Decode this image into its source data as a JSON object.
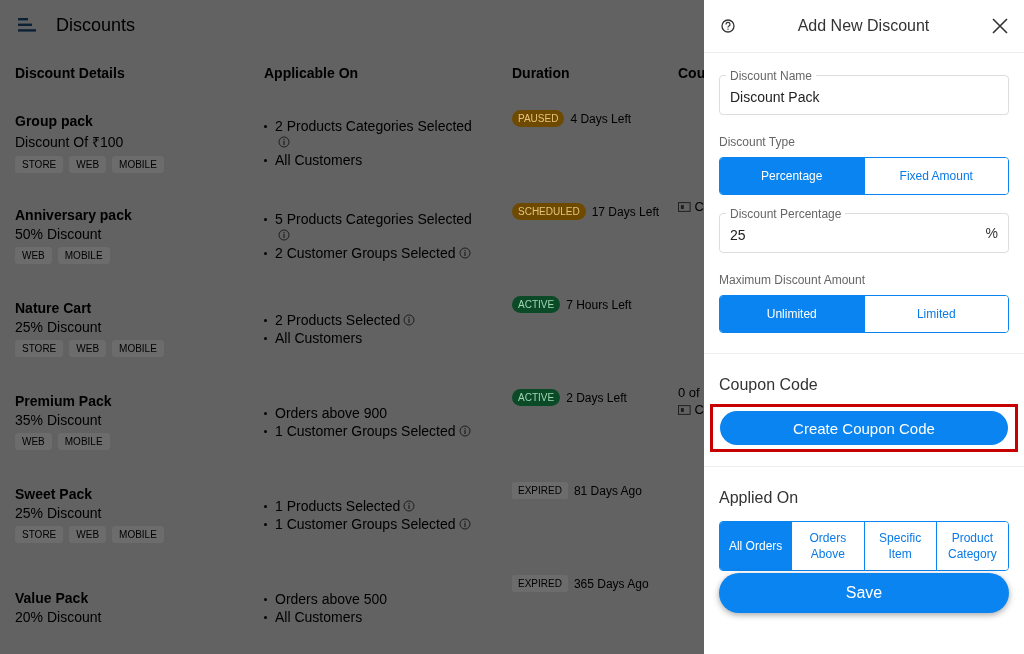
{
  "page": {
    "title": "Discounts"
  },
  "table": {
    "columns": [
      "Discount Details",
      "Applicable On",
      "Duration",
      "Cou"
    ],
    "rows": [
      {
        "name": "Group pack",
        "amount": "Discount Of ₹100",
        "channels": [
          "STORE",
          "WEB",
          "MOBILE"
        ],
        "applicable": [
          {
            "text": "2 Products Categories Selected",
            "info": true
          },
          {
            "text": "All Customers",
            "info": false
          }
        ],
        "status": {
          "kind": "paused",
          "label": "PAUSED"
        },
        "time": "4 Days Left",
        "coupons": []
      },
      {
        "name": "Anniversary pack",
        "amount": "50% Discount",
        "channels": [
          "WEB",
          "MOBILE"
        ],
        "applicable": [
          {
            "text": "5 Products Categories Selected",
            "info": true
          },
          {
            "text": "2 Customer Groups Selected",
            "info": true
          }
        ],
        "status": {
          "kind": "scheduled",
          "label": "SCHEDULED"
        },
        "time": "17 Days Left",
        "coupons": [
          {
            "kind": "ticket",
            "text": "C"
          }
        ]
      },
      {
        "name": "Nature Cart",
        "amount": "25% Discount",
        "channels": [
          "STORE",
          "WEB",
          "MOBILE"
        ],
        "applicable": [
          {
            "text": "2 Products Selected",
            "info": true
          },
          {
            "text": "All Customers",
            "info": false
          }
        ],
        "status": {
          "kind": "active",
          "label": "ACTIVE"
        },
        "time": "7 Hours Left",
        "coupons": []
      },
      {
        "name": "Premium Pack",
        "amount": "35% Discount",
        "channels": [
          "WEB",
          "MOBILE"
        ],
        "applicable": [
          {
            "text": "Orders above 900",
            "info": false
          },
          {
            "text": "1 Customer Groups Selected",
            "info": true
          }
        ],
        "status": {
          "kind": "active",
          "label": "ACTIVE"
        },
        "time": "2 Days Left",
        "coupons": [
          {
            "kind": "text",
            "text": "0 of"
          },
          {
            "kind": "ticket",
            "text": "C"
          }
        ]
      },
      {
        "name": "Sweet Pack",
        "amount": "25% Discount",
        "channels": [
          "STORE",
          "WEB",
          "MOBILE"
        ],
        "applicable": [
          {
            "text": "1 Products Selected",
            "info": true
          },
          {
            "text": "1 Customer Groups Selected",
            "info": true
          }
        ],
        "status": {
          "kind": "expired",
          "label": "EXPIRED"
        },
        "time": "81 Days Ago",
        "coupons": []
      },
      {
        "name": "Value Pack",
        "amount": "20% Discount",
        "channels": [],
        "applicable": [
          {
            "text": "Orders above 500",
            "info": false
          },
          {
            "text": "All Customers",
            "info": false
          }
        ],
        "status": {
          "kind": "expired",
          "label": "EXPIRED"
        },
        "time": "365 Days Ago",
        "coupons": []
      }
    ]
  },
  "panel": {
    "title": "Add New Discount",
    "name_field": {
      "label": "Discount Name",
      "value": "Discount Pack"
    },
    "discount_type": {
      "label": "Discount Type",
      "options": [
        {
          "label": "Percentage",
          "selected": true
        },
        {
          "label": "Fixed Amount",
          "selected": false
        }
      ]
    },
    "percentage_field": {
      "label": "Discount Percentage",
      "value": "25",
      "suffix": "%"
    },
    "max_amount": {
      "label": "Maximum Discount Amount",
      "options": [
        {
          "label": "Unlimited",
          "selected": true
        },
        {
          "label": "Limited",
          "selected": false
        }
      ]
    },
    "coupon": {
      "heading": "Coupon Code",
      "button": "Create Coupon Code",
      "highlighted": true
    },
    "applied_on": {
      "heading": "Applied On",
      "options": [
        {
          "label": "All Orders",
          "selected": true
        },
        {
          "label": "Orders Above",
          "selected": false
        },
        {
          "label": "Specific Item",
          "selected": false
        },
        {
          "label": "Product Category",
          "selected": false
        }
      ]
    },
    "save": "Save"
  }
}
